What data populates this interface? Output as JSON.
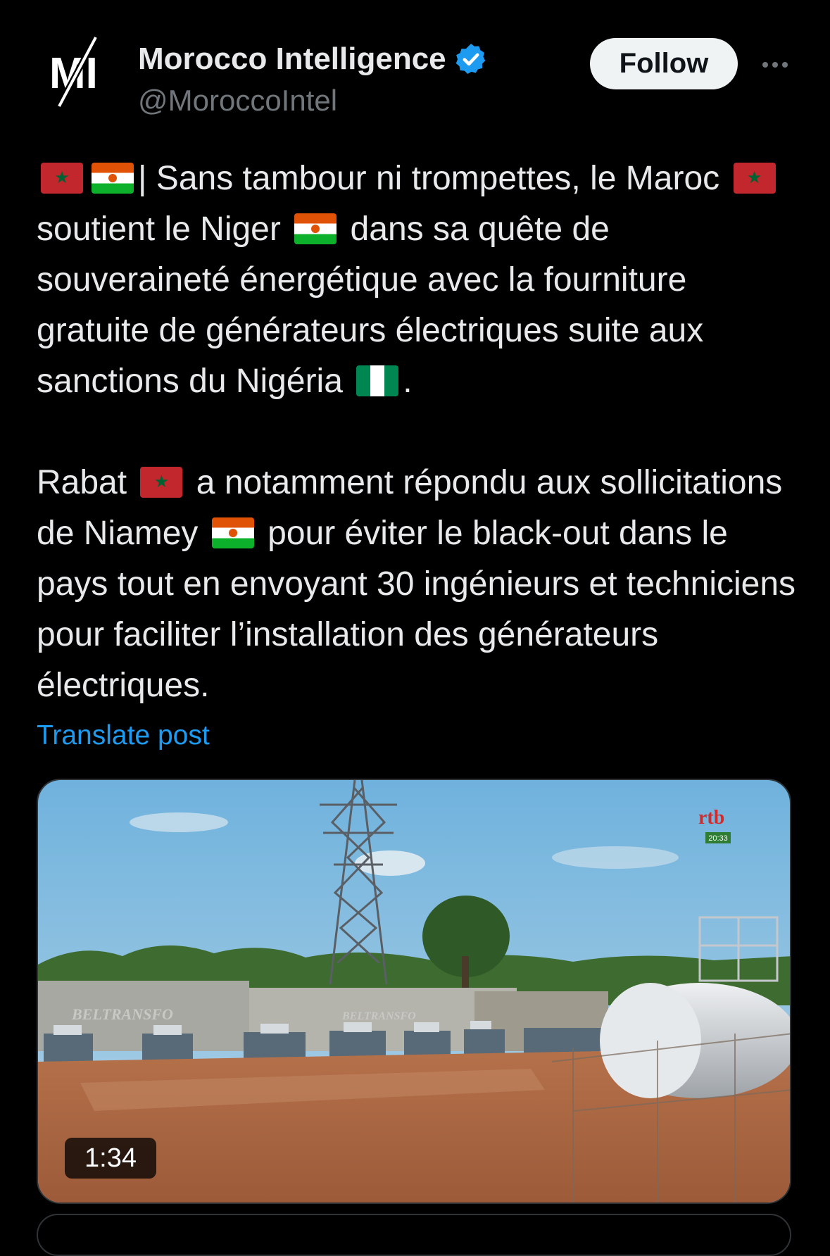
{
  "account": {
    "name": "Morocco Intelligence",
    "handle": "@MoroccoIntel",
    "avatar_text": "MI",
    "verified_icon": "verified-badge-icon"
  },
  "actions": {
    "follow_label": "Follow",
    "more_icon": "more-options-icon"
  },
  "tweet": {
    "p1_part1": "| Sans tambour ni trompettes, le Maroc",
    "p1_part2": "soutient le Niger",
    "p1_part3": "dans sa quête de souveraineté énergétique avec la fourniture gratuite de générateurs électriques suite aux sanctions du Nigéria",
    "p1_part4": ".",
    "p2_part1": "Rabat",
    "p2_part2": "a notamment répondu aux sollicitations de Niamey",
    "p2_part3": "pour éviter le black-out dans le pays tout en envoyant 30 ingénieurs et techniciens pour faciliter l’installation des générateurs électriques."
  },
  "translate_label": "Translate post",
  "video": {
    "duration": "1:34",
    "channel_logo": "rtb",
    "channel_time": "20:33",
    "container_label_1": "BELTRANSFO",
    "container_label_2": "BELTRANSFO"
  },
  "colors": {
    "background": "#000000",
    "text": "#e7e9ea",
    "secondary": "#71767b",
    "link": "#1d9bf0",
    "verified": "#1d9bf0"
  }
}
